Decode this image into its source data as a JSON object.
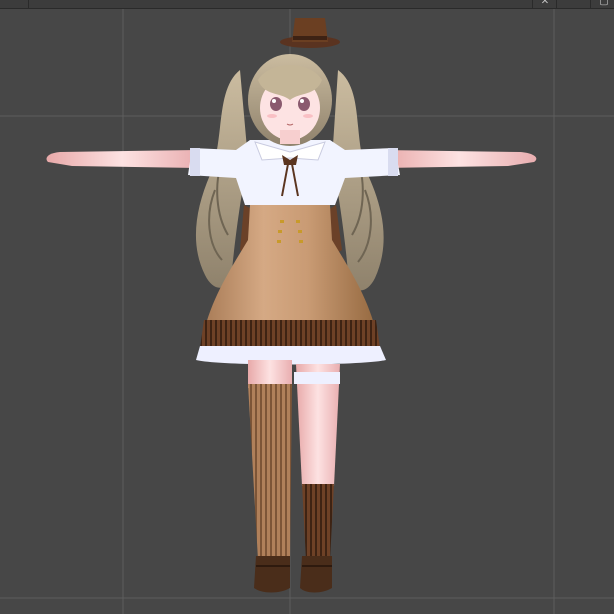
{
  "toolbar": {
    "left_label": "",
    "icons": [
      "crosshair-icon",
      "window-icon"
    ]
  },
  "viewport": {
    "background": "#474747",
    "grid_color": "#5e5e5e"
  },
  "model": {
    "pose": "T-pose",
    "hat_color": "#6b3f22",
    "hair_color": "#b3a58c",
    "blouse_color": "#f2f4ff",
    "dress_color": "#c99b74",
    "stocking_color": "#a97a56",
    "shoe_color": "#4a2d1a",
    "skin_color": "#f7c9c9"
  }
}
